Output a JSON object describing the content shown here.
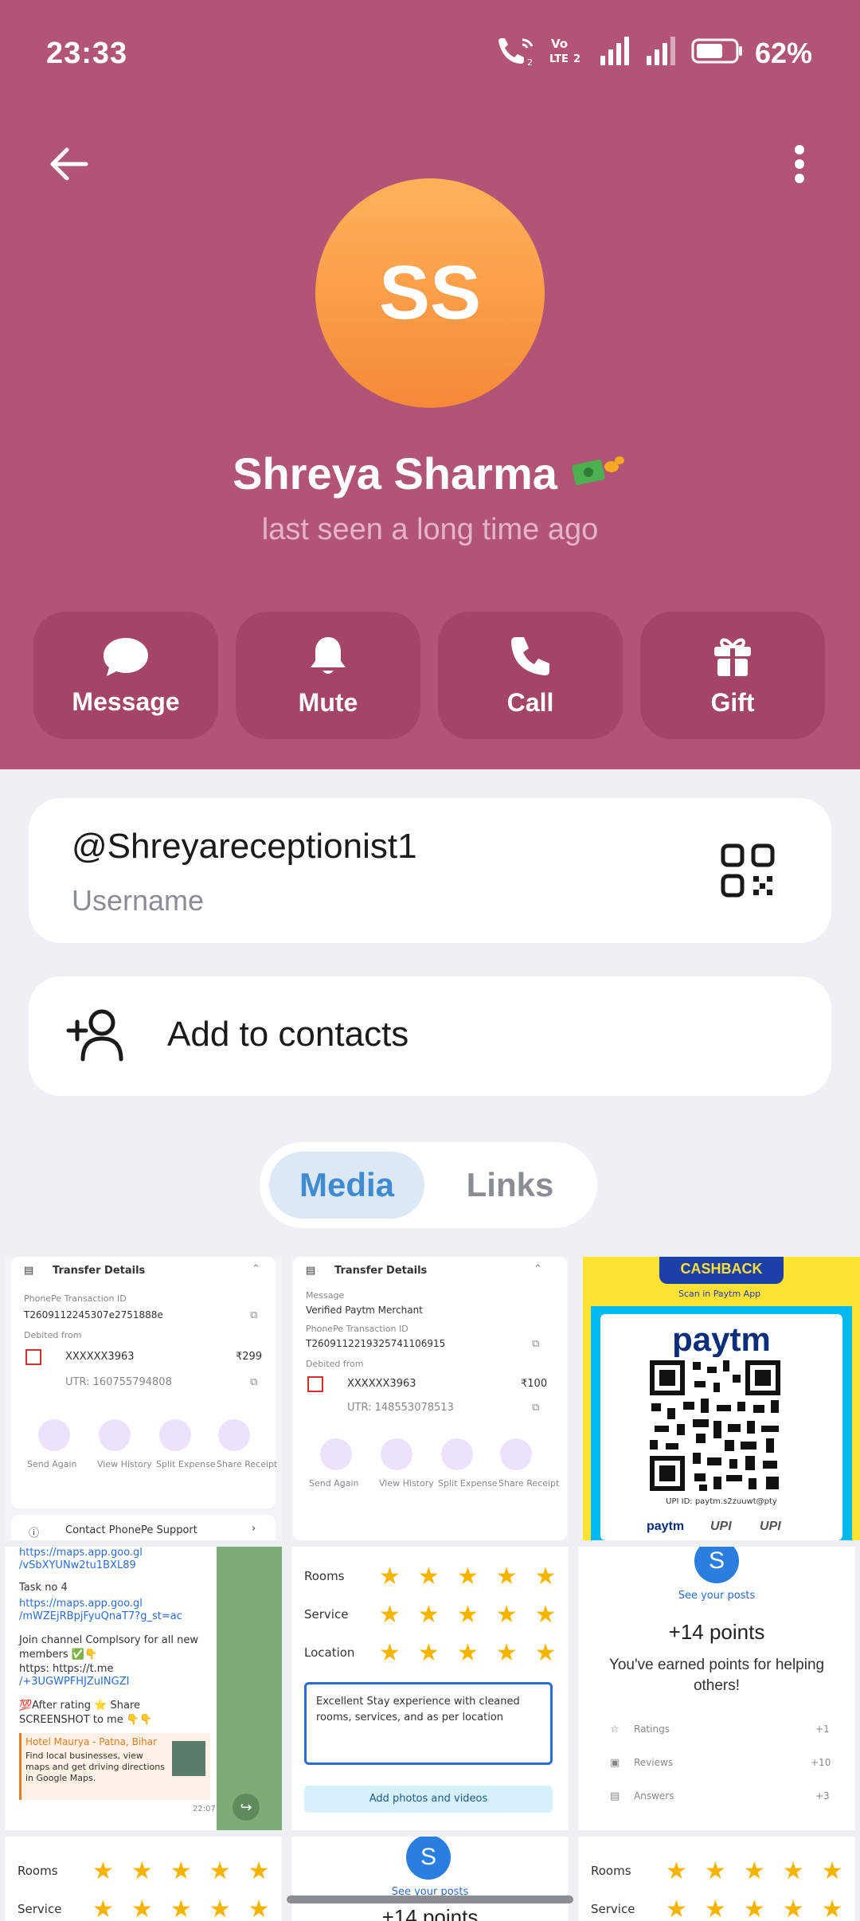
{
  "status_bar": {
    "time": "23:33",
    "battery": "62%"
  },
  "profile": {
    "initials": "SS",
    "name": "Shreya Sharma",
    "last_seen": "last seen a long time ago",
    "avatar_colors": [
      "#ffb25a",
      "#f58a38"
    ],
    "header_color": "#b25475"
  },
  "actions": [
    {
      "label": "Message",
      "icon": "chat-bubble-icon"
    },
    {
      "label": "Mute",
      "icon": "bell-icon"
    },
    {
      "label": "Call",
      "icon": "phone-icon"
    },
    {
      "label": "Gift",
      "icon": "gift-icon"
    }
  ],
  "username_card": {
    "value": "@Shreyareceptionist1",
    "label": "Username",
    "icon": "qr-code-icon"
  },
  "add_contact": {
    "label": "Add to contacts",
    "icon": "add-person-icon"
  },
  "tabs": {
    "media": "Media",
    "links": "Links",
    "active": "Media"
  },
  "media": {
    "t1": {
      "title": "Transfer Details",
      "txn_label": "PhonePe Transaction ID",
      "txn_id": "T2609112245307e2751888e",
      "debited_label": "Debited from",
      "account": "XXXXXX3963",
      "amount": "₹299",
      "utr": "UTR: 160755794808",
      "actions": [
        "Send Again",
        "View History",
        "Split Expense",
        "Share Receipt"
      ],
      "support": "Contact PhonePe Support"
    },
    "t2": {
      "title": "Transfer Details",
      "msg_label": "Message",
      "msg": "Verified Paytm Merchant",
      "txn_label": "PhonePe Transaction ID",
      "txn_id": "T2609112219325741106915",
      "debited_label": "Debited from",
      "account": "XXXXXX3963",
      "amount": "₹100",
      "utr": "UTR: 148553078513",
      "actions": [
        "Send Again",
        "View History",
        "Split Expense",
        "Share Receipt"
      ]
    },
    "t3": {
      "banner": "CASHBACK",
      "scan": "Scan in Paytm App",
      "brand": "paytm",
      "upi": "UPI ID: paytm.s2zuuwt@pty"
    },
    "t4": {
      "lines": [
        "https://maps.app.goo.gl",
        "/vSbXYUNw2tu1BXL89",
        "Task no 4",
        "https://maps.app.goo.gl",
        "/mWZEjRBpjFyuQnaT7?g_st=ac",
        "Join channel Complsory for all new",
        "members ✅👇",
        "https: https://t.me",
        "/+3UGWPFHJZuINGZI",
        "💯After rating ⭐ Share",
        "SCREENSHOT to me 👇👇"
      ],
      "card_title": "Hotel Maurya - Patna, Bihar",
      "card_desc": "Find local businesses, view maps and get driving directions in Google Maps.",
      "time": "22:07"
    },
    "t5": {
      "rows": [
        "Rooms",
        "Service",
        "Location"
      ],
      "review": "Excellent Stay experience with cleaned rooms, services, and as per location",
      "button": "Add photos and videos"
    },
    "t6": {
      "avatar": "S",
      "link": "See your posts",
      "points": "+14 points",
      "msg": "You've earned points for helping others!",
      "items": [
        {
          "label": "Ratings",
          "value": "+1"
        },
        {
          "label": "Reviews",
          "value": "+10"
        },
        {
          "label": "Answers",
          "value": "+3"
        }
      ]
    },
    "t7": {
      "rows": [
        "Rooms",
        "Service"
      ]
    },
    "t8": {
      "avatar": "S",
      "link": "See your posts",
      "points": "+14 points"
    },
    "t9": {
      "rows": [
        "Rooms",
        "Service"
      ]
    }
  }
}
